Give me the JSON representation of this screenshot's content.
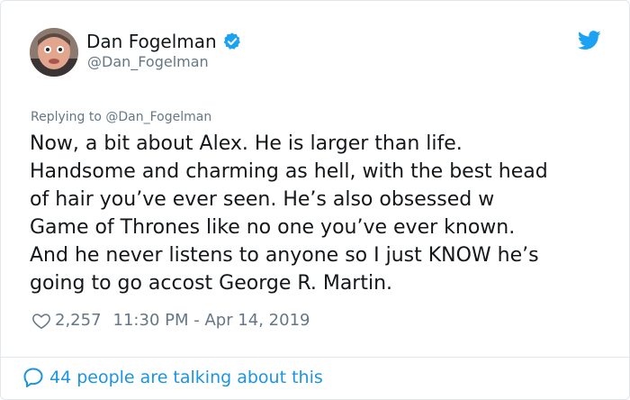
{
  "tweet": {
    "author": {
      "display_name": "Dan Fogelman",
      "handle": "@Dan_Fogelman",
      "verified": true,
      "avatar_icon": "user-avatar-photo"
    },
    "replying_to": "Replying to @Dan_Fogelman",
    "text": "Now, a bit about Alex. He is larger than life.\nHandsome and charming as hell, with the best head\nof hair you’ve ever seen.  He’s also obsessed w\nGame of Thrones like no one you’ve ever known.\nAnd he never listens to anyone so I just KNOW he’s\ngoing to go accost George R. Martin.",
    "likes": "2,257",
    "timestamp": "11:30 PM - Apr 14, 2019",
    "conversation_text": "44 people are talking about this"
  },
  "icons": {
    "brand": "twitter-bird-icon",
    "verified": "verified-badge-icon",
    "like": "heart-icon",
    "reply": "speech-bubble-icon"
  },
  "colors": {
    "brand_blue": "#1da1f2",
    "link_blue": "#1b95e0",
    "text": "#14171a",
    "muted": "#657786",
    "border": "#e1e8ed"
  }
}
